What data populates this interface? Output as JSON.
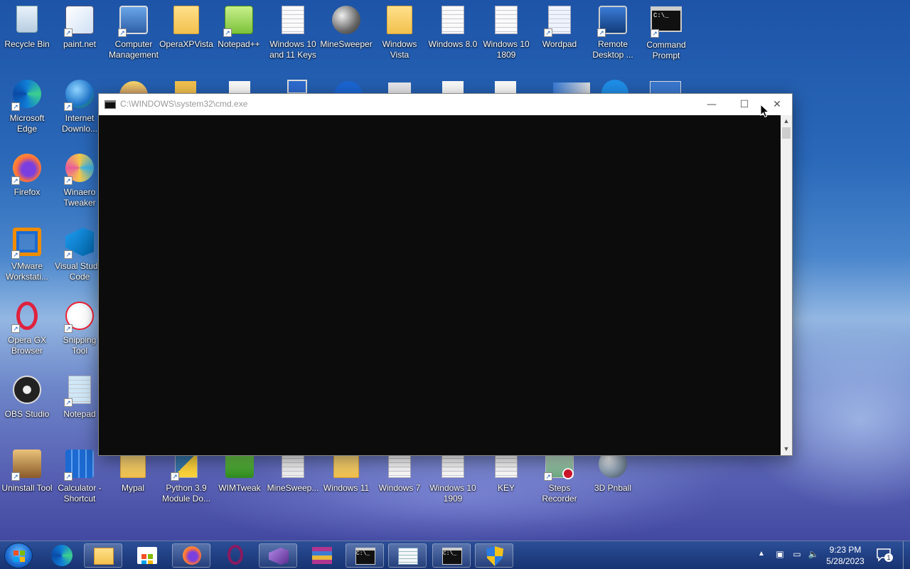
{
  "desktop": {
    "row1": [
      {
        "label": "Recycle Bin",
        "icon": "recycle-bin-icon"
      },
      {
        "label": "paint.net",
        "icon": "paint-net-icon"
      },
      {
        "label": "Computer\nManagement",
        "icon": "computer-management-icon"
      },
      {
        "label": "OperaXPVista",
        "icon": "folder-icon"
      },
      {
        "label": "Notepad++",
        "icon": "notepad-plus-plus-icon"
      },
      {
        "label": "Windows 10\nand 11 Keys",
        "icon": "text-document-icon"
      },
      {
        "label": "MineSweeper",
        "icon": "mine-icon"
      },
      {
        "label": "Windows\nVista",
        "icon": "folder-icon"
      },
      {
        "label": "Windows 8.0",
        "icon": "text-document-icon"
      },
      {
        "label": "Windows 10\n1809",
        "icon": "text-document-icon"
      },
      {
        "label": "Wordpad",
        "icon": "wordpad-icon"
      },
      {
        "label": "Remote\nDesktop ...",
        "icon": "remote-desktop-icon"
      },
      {
        "label": "Command\nPrompt",
        "icon": "command-prompt-icon"
      }
    ],
    "left_column": [
      {
        "label": "Microsoft\nEdge",
        "icon": "edge-icon"
      },
      {
        "label": "Internet\nDownlo...",
        "icon": "internet-download-manager-icon"
      },
      {
        "label": "Firefox",
        "icon": "firefox-icon"
      },
      {
        "label": "Winaero\nTweaker",
        "icon": "winaero-tweaker-icon"
      },
      {
        "label": "VMware\nWorkstati...",
        "icon": "vmware-icon"
      },
      {
        "label": "Visual Studio\nCode",
        "icon": "vscode-icon"
      },
      {
        "label": "Opera GX\nBrowser",
        "icon": "opera-gx-icon"
      },
      {
        "label": "Snipping\nTool",
        "icon": "snipping-tool-icon"
      },
      {
        "label": "OBS Studio",
        "icon": "obs-icon"
      },
      {
        "label": "Notepad",
        "icon": "notepad-icon"
      }
    ],
    "bottom_row": [
      {
        "label": "Uninstall Tool",
        "icon": "uninstall-tool-icon"
      },
      {
        "label": "Calculator -\nShortcut",
        "icon": "calculator-icon"
      },
      {
        "label": "Mypal",
        "icon": "folder-icon"
      },
      {
        "label": "Python 3.9\nModule Do...",
        "icon": "python-icon"
      },
      {
        "label": "WIMTweak",
        "icon": "wimtweak-icon"
      },
      {
        "label": "MineSweep...",
        "icon": "minesweeper-gear-icon"
      },
      {
        "label": "Windows 11",
        "icon": "folder-icon"
      },
      {
        "label": "Windows 7",
        "icon": "text-document-icon"
      },
      {
        "label": "Windows 10\n1909",
        "icon": "text-document-icon"
      },
      {
        "label": "KEY",
        "icon": "text-document-icon"
      },
      {
        "label": "Steps\nRecorder",
        "icon": "steps-recorder-icon"
      },
      {
        "label": "3D Pnball",
        "icon": "pinball-icon"
      }
    ]
  },
  "cmd_window": {
    "title": "C:\\WINDOWS\\system32\\cmd.exe",
    "minimize_glyph": "—",
    "maximize_glyph": "☐",
    "close_glyph": "✕",
    "console_text": ""
  },
  "taskbar": {
    "buttons": [
      {
        "name": "taskbar-edge",
        "icon": "edge-icon"
      },
      {
        "name": "taskbar-file-explorer",
        "icon": "folder-icon"
      },
      {
        "name": "taskbar-store",
        "icon": "store-icon"
      },
      {
        "name": "taskbar-firefox",
        "icon": "firefox-icon"
      },
      {
        "name": "taskbar-opera",
        "icon": "opera-icon"
      },
      {
        "name": "taskbar-visual-studio-installer",
        "icon": "visual-studio-icon"
      },
      {
        "name": "taskbar-winrar",
        "icon": "archive-icon"
      },
      {
        "name": "taskbar-cmd-1",
        "icon": "command-prompt-icon"
      },
      {
        "name": "taskbar-wordpad",
        "icon": "wordpad-icon"
      },
      {
        "name": "taskbar-cmd-2",
        "icon": "command-prompt-icon"
      },
      {
        "name": "taskbar-uac-shield",
        "icon": "shield-icon"
      }
    ],
    "clock_time": "9:23 PM",
    "clock_date": "5/28/2023",
    "notification_count": "1"
  },
  "colors": {
    "console_bg": "#0c0c0c",
    "accent": "#1d54a8"
  }
}
